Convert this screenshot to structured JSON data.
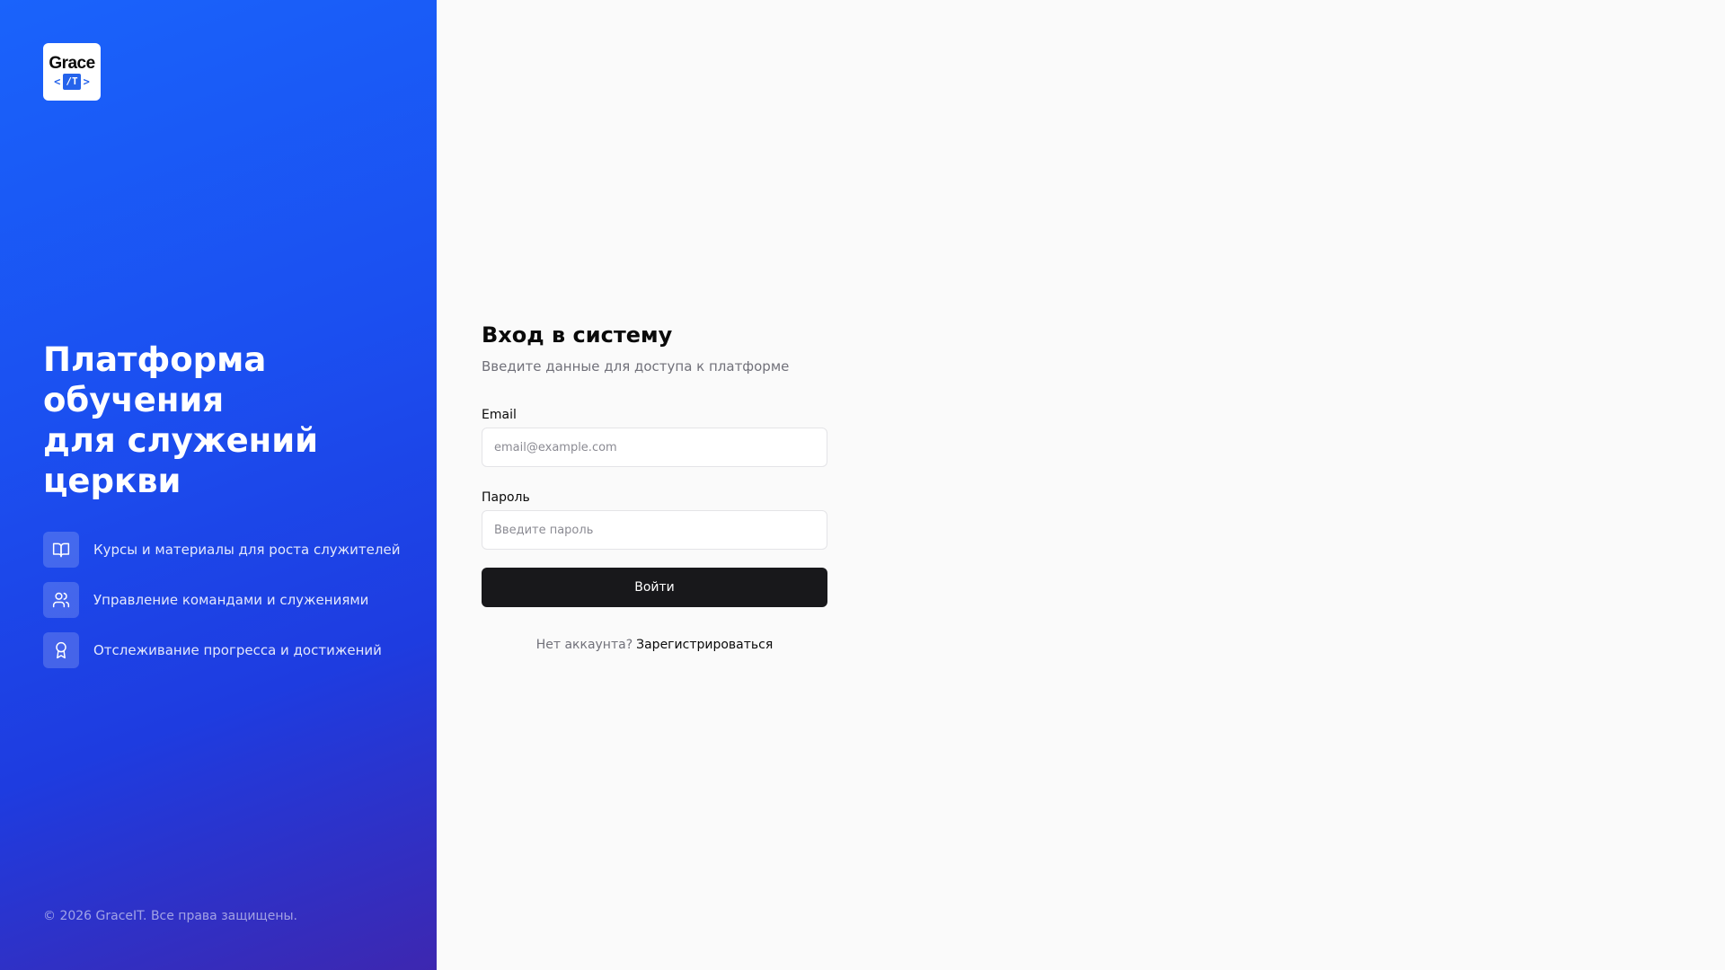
{
  "brand": {
    "logo_word": "Grace",
    "logo_bracket_left": "<",
    "logo_code": "/T",
    "logo_bracket_right": ">",
    "accent": "#2563eb"
  },
  "hero": {
    "title_lines": [
      "Платформа",
      "обучения",
      "для служений",
      "церкви"
    ]
  },
  "features": [
    {
      "icon": "book-open-icon",
      "text": "Курсы и материалы для роста служителей"
    },
    {
      "icon": "users-icon",
      "text": "Управление командами и служениями"
    },
    {
      "icon": "award-icon",
      "text": "Отслеживание прогресса и достижений"
    }
  ],
  "footer": {
    "copyright": "© 2026 GraceIT. Все права защищены."
  },
  "login": {
    "title": "Вход в систему",
    "subtitle": "Введите данные для доступа к платформе",
    "email_label": "Email",
    "email_value": "",
    "email_placeholder": "email@example.com",
    "password_label": "Пароль",
    "password_value": "",
    "password_placeholder": "Введите пароль",
    "submit_label": "Войти",
    "no_account_text": "Нет аккаунта?",
    "register_link": "Зарегистрироваться"
  },
  "colors": {
    "panel_gradient_start": "#1a63fb",
    "panel_gradient_end": "#3d27b0",
    "button_bg": "#18181b",
    "page_bg": "#fafafa"
  }
}
